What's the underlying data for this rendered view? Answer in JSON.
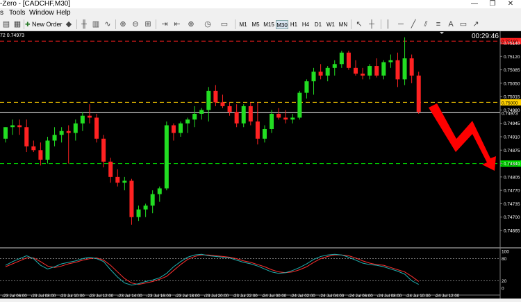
{
  "window": {
    "title": "-Zero - [CADCHF,M30]",
    "controls": [
      "—",
      "❐",
      "✕"
    ]
  },
  "menu": [
    "s",
    "Tools",
    "Window",
    "Help"
  ],
  "toolbar": {
    "new_order": "New Order",
    "timeframes": [
      "M1",
      "M5",
      "M15",
      "M30",
      "H1",
      "H4",
      "D1",
      "W1",
      "MN"
    ],
    "active_timeframe": "M30"
  },
  "chart_info": {
    "header": "72 0.74973",
    "countdown": "00:29:46"
  },
  "chart_data": {
    "type": "candlestick",
    "symbol": "CADCHF",
    "timeframe": "M30",
    "ylim": [
      0.74665,
      0.75165
    ],
    "price_ticks": [
      "0.75140",
      "0.75120",
      "0.75085",
      "0.75050",
      "0.75015",
      "0.74980",
      "0.74945",
      "0.74910",
      "0.74875",
      "0.74840",
      "0.74805",
      "0.74770",
      "0.74735",
      "0.74700",
      "0.74665"
    ],
    "tick_values": [
      0.75155,
      0.7512,
      0.75085,
      0.7505,
      0.75015,
      0.7498,
      0.74945,
      0.7491,
      0.74875,
      0.7484,
      0.74805,
      0.7477,
      0.74735,
      0.747,
      0.74665
    ],
    "levels": [
      {
        "price": 0.7516,
        "label": "0.75160",
        "color": "#ff2020"
      },
      {
        "price": 0.75,
        "label": "0.75000",
        "color": "#ffd000"
      },
      {
        "price": 0.74973,
        "label": "0.74973",
        "color": "#ffffff"
      },
      {
        "price": 0.7484,
        "label": "0.74840",
        "color": "#00dd00"
      }
    ],
    "time_labels": [
      "23 Jul 06:00",
      "23 Jul 08:00",
      "23 Jul 10:00",
      "23 Jul 12:00",
      "23 Jul 14:00",
      "23 Jul 16:00",
      "23 Jul 18:00",
      "23 Jul 20:00",
      "23 Jul 22:00",
      "24 Jul 00:00",
      "24 Jul 02:00",
      "24 Jul 04:00",
      "24 Jul 06:00",
      "24 Jul 08:00",
      "24 Jul 10:00",
      "24 Jul 12:00"
    ],
    "candles": [
      [
        0.74905,
        0.74935,
        0.74895,
        0.74935
      ],
      [
        0.74935,
        0.74955,
        0.74915,
        0.7494
      ],
      [
        0.7494,
        0.74955,
        0.74915,
        0.74935
      ],
      [
        0.74935,
        0.74955,
        0.7487,
        0.74885
      ],
      [
        0.74885,
        0.749,
        0.7487,
        0.74875
      ],
      [
        0.74875,
        0.74895,
        0.74835,
        0.7485
      ],
      [
        0.7485,
        0.7491,
        0.7484,
        0.749
      ],
      [
        0.749,
        0.74935,
        0.74885,
        0.74915
      ],
      [
        0.74915,
        0.74935,
        0.74895,
        0.74925
      ],
      [
        0.74925,
        0.7494,
        0.7484,
        0.7492
      ],
      [
        0.7492,
        0.74955,
        0.749,
        0.74945
      ],
      [
        0.74945,
        0.74975,
        0.74925,
        0.74965
      ],
      [
        0.74965,
        0.74995,
        0.74945,
        0.7496
      ],
      [
        0.7496,
        0.7497,
        0.74895,
        0.74905
      ],
      [
        0.74905,
        0.74915,
        0.7483,
        0.74845
      ],
      [
        0.74845,
        0.74855,
        0.7479,
        0.74805
      ],
      [
        0.74805,
        0.74825,
        0.7478,
        0.7479
      ],
      [
        0.7479,
        0.74805,
        0.7477,
        0.74795
      ],
      [
        0.74795,
        0.748,
        0.7468,
        0.747
      ],
      [
        0.747,
        0.7473,
        0.7469,
        0.7472
      ],
      [
        0.7472,
        0.74735,
        0.747,
        0.7473
      ],
      [
        0.7473,
        0.7477,
        0.7471,
        0.7476
      ],
      [
        0.7476,
        0.7478,
        0.7474,
        0.74775
      ],
      [
        0.74775,
        0.7495,
        0.7477,
        0.7494
      ],
      [
        0.7494,
        0.74945,
        0.749,
        0.7492
      ],
      [
        0.7492,
        0.7495,
        0.7491,
        0.74945
      ],
      [
        0.74945,
        0.7496,
        0.7492,
        0.74955
      ],
      [
        0.74955,
        0.7499,
        0.74935,
        0.7497
      ],
      [
        0.7497,
        0.74985,
        0.74955,
        0.7498
      ],
      [
        0.7498,
        0.7504,
        0.7495,
        0.7503
      ],
      [
        0.7503,
        0.75045,
        0.7499,
        0.75
      ],
      [
        0.75,
        0.7502,
        0.74985,
        0.7499
      ],
      [
        0.7499,
        0.75,
        0.74965,
        0.74975
      ],
      [
        0.74975,
        0.74995,
        0.74935,
        0.74945
      ],
      [
        0.74945,
        0.74995,
        0.74935,
        0.7499
      ],
      [
        0.7499,
        0.75,
        0.7494,
        0.7495
      ],
      [
        0.7495,
        0.75,
        0.7489,
        0.74905
      ],
      [
        0.74905,
        0.7494,
        0.74895,
        0.7493
      ],
      [
        0.7493,
        0.7498,
        0.7492,
        0.7497
      ],
      [
        0.7497,
        0.74985,
        0.74955,
        0.7496
      ],
      [
        0.7496,
        0.7498,
        0.74945,
        0.74955
      ],
      [
        0.74955,
        0.7497,
        0.74945,
        0.7496
      ],
      [
        0.7496,
        0.7503,
        0.74955,
        0.75025
      ],
      [
        0.75025,
        0.7506,
        0.7501,
        0.75055
      ],
      [
        0.75055,
        0.7509,
        0.7502,
        0.7508
      ],
      [
        0.7508,
        0.751,
        0.7506,
        0.7507
      ],
      [
        0.7507,
        0.75095,
        0.75055,
        0.7509
      ],
      [
        0.7509,
        0.7511,
        0.7507,
        0.751
      ],
      [
        0.751,
        0.75135,
        0.7509,
        0.7513
      ],
      [
        0.7513,
        0.75135,
        0.75085,
        0.7509
      ],
      [
        0.7509,
        0.7511,
        0.7507,
        0.75075
      ],
      [
        0.75075,
        0.7509,
        0.7506,
        0.7507
      ],
      [
        0.7507,
        0.751,
        0.7506,
        0.75095
      ],
      [
        0.75095,
        0.75115,
        0.75065,
        0.7507
      ],
      [
        0.7507,
        0.7511,
        0.7506,
        0.75105
      ],
      [
        0.75105,
        0.75125,
        0.7509,
        0.7511
      ],
      [
        0.7511,
        0.7513,
        0.7504,
        0.7506
      ],
      [
        0.7506,
        0.7517,
        0.75045,
        0.75115
      ],
      [
        0.75115,
        0.75125,
        0.7505,
        0.7507
      ],
      [
        0.7507,
        0.7508,
        0.7497,
        0.74975
      ]
    ],
    "forecast_arrow_color": "#ff0000",
    "oscillator": {
      "type": "stochastic",
      "levels": [
        80,
        20
      ],
      "scale_labels": [
        "100",
        "80",
        "20",
        "0"
      ],
      "main_color": "#20b0b0",
      "signal_color": "#ff3030",
      "main": [
        62,
        72,
        80,
        88,
        80,
        62,
        52,
        58,
        66,
        70,
        74,
        80,
        84,
        80,
        72,
        50,
        30,
        14,
        8,
        12,
        18,
        22,
        28,
        40,
        58,
        72,
        84,
        90,
        92,
        88,
        86,
        84,
        82,
        76,
        70,
        66,
        60,
        52,
        44,
        40,
        42,
        48,
        56,
        66,
        78,
        86,
        90,
        92,
        90,
        84,
        76,
        68,
        64,
        62,
        58,
        52,
        46,
        38,
        20,
        10
      ],
      "signal": [
        58,
        66,
        74,
        82,
        82,
        72,
        60,
        56,
        60,
        66,
        70,
        76,
        80,
        82,
        76,
        62,
        44,
        26,
        14,
        10,
        14,
        18,
        24,
        32,
        48,
        64,
        78,
        86,
        90,
        90,
        88,
        86,
        84,
        80,
        74,
        70,
        64,
        58,
        50,
        44,
        42,
        44,
        50,
        58,
        70,
        80,
        86,
        90,
        90,
        88,
        82,
        74,
        68,
        64,
        62,
        56,
        50,
        44,
        32,
        18
      ]
    }
  }
}
